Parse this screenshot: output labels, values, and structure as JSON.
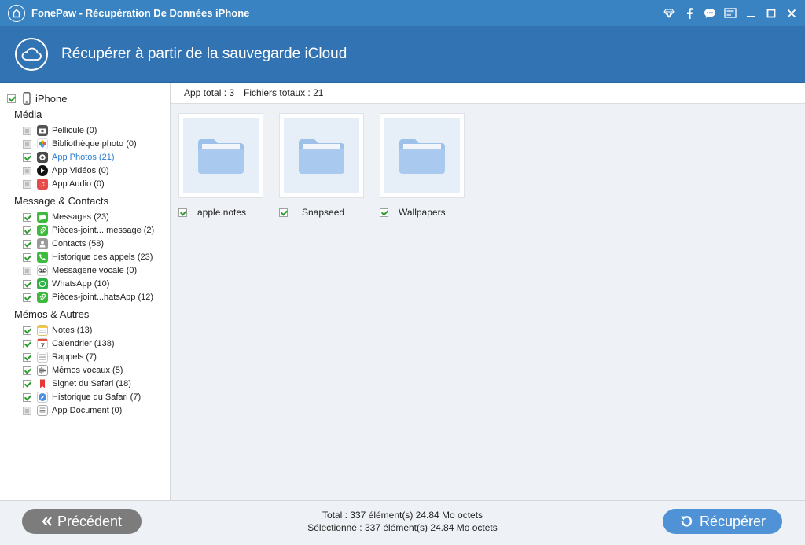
{
  "window": {
    "title": "FonePaw - Récupération De Données iPhone"
  },
  "header": {
    "title": "Récupérer à partir de la sauvegarde iCloud"
  },
  "sidebar": {
    "device": {
      "label": "iPhone",
      "checked": true
    },
    "sections": [
      {
        "title": "Média",
        "items": [
          {
            "label": "Pellicule (0)",
            "checked": false,
            "icon": "camera-icon"
          },
          {
            "label": "Bibliothèque photo (0)",
            "checked": false,
            "icon": "photos-icon"
          },
          {
            "label": "App Photos (21)",
            "checked": true,
            "selected": true,
            "icon": "app-photos-icon"
          },
          {
            "label": "App Vidéos (0)",
            "checked": false,
            "icon": "video-icon"
          },
          {
            "label": "App Audio (0)",
            "checked": false,
            "icon": "music-icon"
          }
        ]
      },
      {
        "title": "Message & Contacts",
        "items": [
          {
            "label": "Messages (23)",
            "checked": true,
            "icon": "messages-icon"
          },
          {
            "label": "Pièces-joint... message (2)",
            "checked": true,
            "icon": "attachment-icon"
          },
          {
            "label": "Contacts (58)",
            "checked": true,
            "icon": "contacts-icon"
          },
          {
            "label": "Historique des appels (23)",
            "checked": true,
            "icon": "phone-icon"
          },
          {
            "label": "Messagerie vocale (0)",
            "checked": false,
            "icon": "voicemail-icon"
          },
          {
            "label": "WhatsApp (10)",
            "checked": true,
            "icon": "whatsapp-icon"
          },
          {
            "label": "Pièces-joint...hatsApp (12)",
            "checked": true,
            "icon": "attachment-icon"
          }
        ]
      },
      {
        "title": "Mémos & Autres",
        "items": [
          {
            "label": "Notes (13)",
            "checked": true,
            "icon": "notes-icon"
          },
          {
            "label": "Calendrier (138)",
            "checked": true,
            "icon": "calendar-icon"
          },
          {
            "label": "Rappels (7)",
            "checked": true,
            "icon": "reminders-icon"
          },
          {
            "label": "Mémos vocaux (5)",
            "checked": true,
            "icon": "voice-memo-icon"
          },
          {
            "label": "Signet du Safari (18)",
            "checked": true,
            "icon": "bookmark-icon"
          },
          {
            "label": "Historique du Safari (7)",
            "checked": true,
            "icon": "safari-icon"
          },
          {
            "label": "App Document (0)",
            "checked": false,
            "icon": "document-icon"
          }
        ]
      }
    ]
  },
  "content": {
    "stats": {
      "app_total": "App total : 3",
      "files_total": "Fichiers totaux : 21"
    },
    "apps": [
      {
        "name": "apple.notes",
        "checked": true
      },
      {
        "name": "Snapseed",
        "checked": true
      },
      {
        "name": "Wallpapers",
        "checked": true
      }
    ]
  },
  "footer": {
    "prev_label": "Précédent",
    "recover_label": "Récupérer",
    "total": "Total : 337 élément(s) 24.84 Mo octets",
    "selected": "Sélectionné : 337 élément(s) 24.84 Mo octets"
  },
  "colors": {
    "titlebar": "#3a83c2",
    "header": "#3273b3",
    "accent": "#2a7bd0",
    "recover_button": "#4f93d6",
    "prev_button": "#7c7c7c"
  }
}
